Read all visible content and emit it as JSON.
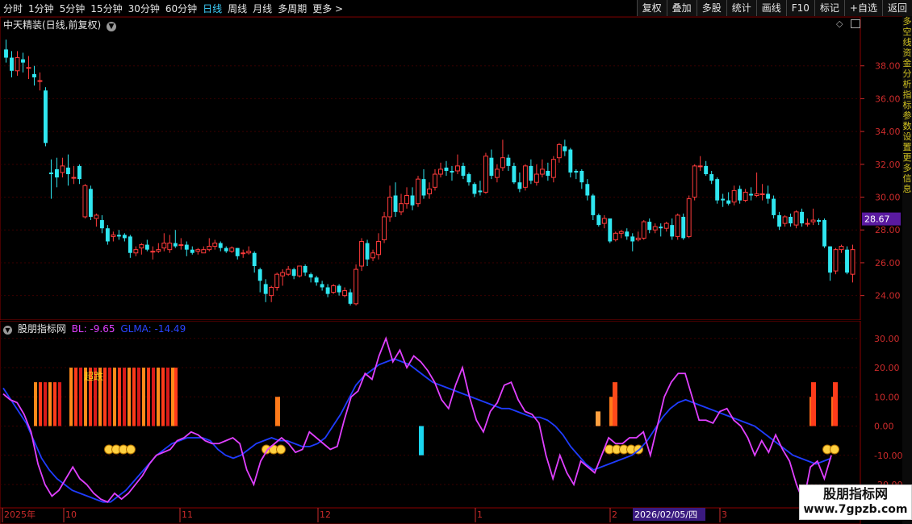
{
  "toolbar": {
    "periods": [
      "分时",
      "1分钟",
      "5分钟",
      "15分钟",
      "30分钟",
      "60分钟",
      "日线",
      "周线",
      "月线",
      "多周期",
      "更多 >"
    ],
    "active_index": 6,
    "right_buttons": [
      "复权",
      "叠加",
      "多股",
      "统计",
      "画线",
      "F10",
      "标记",
      "+自选",
      "返回"
    ]
  },
  "main_chart": {
    "title": "中天精装(日线,前复权)",
    "price_ticks": [
      "38.00",
      "36.00",
      "34.00",
      "32.00",
      "30.00",
      "28.00",
      "26.00",
      "24.00"
    ],
    "current_price": "28.67",
    "current_price_bg": "#5a1aa0"
  },
  "indicator": {
    "name": "股朋指标网",
    "bl_label": "BL: -9.65",
    "glma_label": "GLMA: -14.49",
    "bl_color": "#e040ff",
    "glma_color": "#1f3cff",
    "signal_text": "超跌",
    "ticks": [
      "30.00",
      "20.00",
      "10.00",
      "0.00",
      "-10.00",
      "-20.00"
    ]
  },
  "time_axis": {
    "labels": [
      "2025年",
      "10",
      "11",
      "12",
      "1",
      "2",
      "3"
    ],
    "cursor_date": "2026/02/05/四"
  },
  "watermark": {
    "title": "股朋指标网",
    "url": "www.7gpzb.com"
  },
  "colors": {
    "up": "#ff3b3b",
    "down": "#2fe6f0",
    "grid": "#3a0000",
    "axis_text": "#cc2b2b",
    "border": "#8b0000"
  },
  "chart_data": {
    "type": "candlestick",
    "y_range": [
      23,
      40
    ],
    "candles": [
      [
        39,
        38.5,
        39.6,
        38.2
      ],
      [
        38.5,
        37.7,
        38.9,
        37.3
      ],
      [
        37.7,
        38.5,
        38.9,
        37.4
      ],
      [
        38.4,
        38.2,
        38.8,
        37.6
      ],
      [
        37.9,
        37.9,
        38.6,
        37.2
      ],
      [
        37.5,
        37.3,
        38.0,
        36.8
      ],
      [
        37.1,
        37.1,
        37.6,
        36.5
      ],
      [
        36.5,
        33.3,
        36.7,
        33.1
      ],
      [
        31.5,
        31.4,
        32.3,
        29.9
      ],
      [
        31.7,
        31.2,
        32.4,
        30.6
      ],
      [
        31.5,
        31.9,
        32.4,
        31.2
      ],
      [
        31.8,
        31.4,
        32.6,
        30.7
      ],
      [
        31.2,
        31.2,
        31.9,
        30.8
      ],
      [
        31.9,
        31.1,
        32.0,
        30.8
      ],
      [
        28.8,
        30.7,
        30.8,
        28.7
      ],
      [
        30.5,
        28.8,
        30.7,
        28.6
      ],
      [
        28.7,
        28.9,
        29.0,
        28.2
      ],
      [
        28.6,
        28.1,
        28.9,
        27.8
      ],
      [
        28.1,
        27.3,
        28.3,
        27.1
      ],
      [
        27.6,
        27.7,
        27.9,
        27.3
      ],
      [
        27.7,
        27.6,
        28.0,
        27.4
      ],
      [
        27.7,
        27.5,
        27.8,
        27.3
      ],
      [
        27.6,
        26.6,
        27.7,
        26.3
      ],
      [
        26.6,
        26.8,
        27.0,
        26.4
      ],
      [
        26.9,
        27.1,
        27.2,
        26.5
      ],
      [
        27.1,
        26.8,
        27.4,
        26.7
      ],
      [
        26.7,
        26.7,
        27.0,
        26.2
      ],
      [
        26.7,
        26.8,
        27.2,
        26.6
      ],
      [
        26.9,
        27.2,
        27.8,
        26.7
      ],
      [
        26.8,
        27.2,
        27.7,
        26.6
      ],
      [
        27.2,
        27.0,
        28.0,
        26.9
      ],
      [
        27.1,
        27.1,
        27.5,
        26.8
      ],
      [
        27.1,
        26.8,
        27.3,
        26.4
      ],
      [
        26.8,
        26.6,
        27.0,
        26.5
      ],
      [
        26.7,
        26.8,
        26.9,
        26.5
      ],
      [
        26.6,
        26.8,
        27.0,
        26.6
      ],
      [
        26.8,
        27.0,
        27.5,
        26.7
      ],
      [
        27.0,
        27.2,
        27.4,
        26.8
      ],
      [
        27.2,
        26.9,
        27.3,
        26.7
      ],
      [
        26.9,
        26.7,
        27.0,
        26.6
      ],
      [
        26.7,
        26.9,
        27.0,
        26.6
      ],
      [
        26.9,
        26.4,
        26.9,
        26.2
      ],
      [
        26.6,
        26.6,
        26.8,
        26.3
      ],
      [
        26.6,
        26.7,
        27.0,
        26.5
      ],
      [
        26.6,
        25.8,
        26.7,
        25.4
      ],
      [
        25.6,
        24.9,
        25.7,
        24.2
      ],
      [
        24.7,
        24.1,
        25.0,
        23.6
      ],
      [
        24.0,
        24.5,
        24.6,
        23.6
      ],
      [
        24.5,
        25.3,
        25.4,
        24.3
      ],
      [
        25.2,
        25.4,
        25.6,
        24.6
      ],
      [
        25.3,
        25.6,
        25.8,
        25.2
      ],
      [
        25.6,
        25.2,
        25.7,
        25.0
      ],
      [
        25.2,
        25.8,
        25.8,
        25.1
      ],
      [
        25.8,
        25.4,
        25.9,
        25.2
      ],
      [
        25.3,
        25.1,
        25.4,
        24.8
      ],
      [
        25.1,
        24.8,
        25.2,
        24.6
      ],
      [
        24.7,
        24.5,
        24.9,
        24.3
      ],
      [
        24.5,
        24.1,
        24.7,
        23.9
      ],
      [
        24.2,
        24.6,
        24.7,
        24.1
      ],
      [
        24.6,
        24.2,
        24.7,
        24.0
      ],
      [
        24.0,
        24.3,
        24.5,
        23.9
      ],
      [
        24.2,
        23.5,
        24.4,
        23.4
      ],
      [
        23.5,
        25.6,
        25.9,
        23.4
      ],
      [
        25.8,
        27.3,
        27.5,
        25.5
      ],
      [
        27.2,
        26.2,
        27.4,
        25.8
      ],
      [
        26.3,
        26.6,
        26.8,
        26.1
      ],
      [
        26.5,
        27.3,
        27.8,
        26.2
      ],
      [
        27.4,
        28.8,
        29.1,
        27.2
      ],
      [
        28.8,
        30.0,
        30.7,
        28.5
      ],
      [
        30.1,
        29.1,
        30.9,
        28.8
      ],
      [
        29.1,
        29.6,
        30.2,
        28.9
      ],
      [
        29.6,
        30.1,
        30.6,
        29.3
      ],
      [
        30.1,
        29.5,
        30.6,
        29.2
      ],
      [
        29.6,
        31.1,
        31.3,
        29.4
      ],
      [
        31.1,
        30.1,
        31.7,
        29.9
      ],
      [
        30.2,
        30.5,
        30.9,
        29.9
      ],
      [
        30.6,
        31.4,
        31.7,
        30.4
      ],
      [
        31.4,
        31.7,
        32.1,
        31.2
      ],
      [
        31.8,
        31.6,
        32.2,
        31.3
      ],
      [
        31.6,
        31.5,
        31.9,
        31.0
      ],
      [
        31.6,
        31.9,
        32.6,
        31.4
      ],
      [
        31.9,
        31.3,
        32.1,
        31.1
      ],
      [
        31.4,
        30.9,
        31.5,
        30.7
      ],
      [
        30.8,
        30.2,
        30.9,
        30.0
      ],
      [
        30.4,
        30.3,
        31.0,
        30.1
      ],
      [
        30.3,
        32.5,
        32.7,
        30.2
      ],
      [
        32.4,
        31.3,
        32.9,
        31.1
      ],
      [
        31.2,
        31.7,
        32.0,
        30.9
      ],
      [
        31.8,
        32.4,
        33.5,
        31.6
      ],
      [
        32.4,
        31.9,
        32.6,
        31.6
      ],
      [
        31.9,
        30.9,
        32.1,
        30.8
      ],
      [
        30.9,
        30.5,
        31.5,
        30.3
      ],
      [
        30.6,
        31.9,
        32.0,
        30.4
      ],
      [
        31.9,
        31.0,
        32.3,
        30.8
      ],
      [
        30.9,
        31.4,
        32.0,
        30.7
      ],
      [
        31.4,
        31.7,
        32.3,
        31.2
      ],
      [
        31.6,
        31.3,
        32.1,
        31.0
      ],
      [
        31.2,
        32.3,
        32.5,
        30.9
      ],
      [
        32.4,
        33.2,
        33.3,
        32.1
      ],
      [
        33.1,
        32.8,
        33.5,
        32.5
      ],
      [
        32.9,
        31.5,
        33.0,
        31.2
      ],
      [
        31.6,
        31.5,
        31.7,
        31.1
      ],
      [
        31.6,
        30.9,
        31.7,
        30.5
      ],
      [
        30.8,
        30.1,
        31.1,
        29.8
      ],
      [
        30.1,
        28.9,
        30.2,
        28.6
      ],
      [
        28.9,
        28.3,
        29.0,
        28.2
      ],
      [
        28.4,
        28.7,
        28.9,
        28.1
      ],
      [
        28.7,
        27.3,
        28.7,
        27.2
      ],
      [
        27.4,
        27.8,
        27.9,
        27.3
      ],
      [
        27.8,
        27.9,
        28.0,
        27.5
      ],
      [
        27.9,
        27.6,
        28.1,
        27.4
      ],
      [
        27.6,
        27.3,
        27.8,
        26.7
      ],
      [
        27.4,
        27.5,
        27.9,
        27.3
      ],
      [
        27.5,
        28.5,
        28.6,
        27.4
      ],
      [
        28.5,
        28.0,
        28.7,
        27.8
      ],
      [
        28.0,
        28.2,
        28.4,
        27.8
      ],
      [
        28.2,
        28.1,
        28.4,
        27.6
      ],
      [
        28.1,
        28.4,
        28.5,
        27.9
      ],
      [
        28.3,
        27.6,
        28.7,
        27.4
      ],
      [
        27.6,
        28.9,
        29.0,
        27.4
      ],
      [
        28.8,
        27.5,
        29.0,
        27.4
      ],
      [
        27.6,
        29.9,
        30.1,
        27.5
      ],
      [
        30.0,
        31.9,
        32.0,
        29.8
      ],
      [
        31.9,
        31.9,
        32.5,
        31.6
      ],
      [
        31.9,
        31.4,
        32.2,
        31.3
      ],
      [
        31.4,
        31.0,
        31.6,
        30.8
      ],
      [
        31.1,
        29.8,
        31.2,
        29.6
      ],
      [
        29.9,
        29.8,
        30.2,
        29.4
      ],
      [
        29.8,
        29.6,
        30.3,
        29.5
      ],
      [
        29.7,
        30.4,
        30.7,
        29.5
      ],
      [
        30.5,
        29.8,
        30.7,
        29.6
      ],
      [
        29.8,
        30.3,
        30.5,
        29.7
      ],
      [
        30.2,
        30.1,
        30.6,
        29.8
      ],
      [
        30.1,
        30.2,
        31.5,
        30.0
      ],
      [
        30.2,
        30.2,
        30.8,
        29.8
      ],
      [
        30.2,
        29.9,
        30.7,
        29.6
      ],
      [
        29.9,
        28.9,
        30.1,
        28.7
      ],
      [
        28.9,
        28.2,
        29.1,
        28.0
      ],
      [
        28.4,
        28.8,
        28.9,
        28.2
      ],
      [
        28.8,
        28.4,
        29.0,
        28.2
      ],
      [
        28.3,
        29.1,
        29.2,
        28.1
      ],
      [
        29.1,
        28.4,
        29.3,
        28.2
      ],
      [
        28.4,
        28.4,
        28.7,
        28.2
      ],
      [
        28.5,
        28.6,
        29.3,
        28.3
      ],
      [
        28.6,
        28.5,
        28.7,
        28.3
      ],
      [
        28.6,
        27.0,
        28.7,
        26.9
      ],
      [
        27.0,
        25.4,
        27.0,
        24.9
      ],
      [
        25.5,
        26.8,
        26.9,
        25.3
      ],
      [
        26.8,
        27.0,
        27.1,
        26.6
      ],
      [
        26.8,
        25.4,
        27.0,
        25.3
      ],
      [
        25.3,
        26.8,
        27.1,
        24.8
      ]
    ],
    "indicator_series": {
      "BL": [
        11,
        9,
        8,
        4,
        -2,
        -13,
        -20,
        -24,
        -22,
        -18,
        -14,
        -18,
        -20,
        -23,
        -25,
        -26,
        -23,
        -25,
        -23,
        -20,
        -17,
        -13,
        -10,
        -9,
        -8,
        -5,
        -4,
        -2,
        -3,
        -5,
        -6,
        -6,
        -5,
        -4,
        -6,
        -15,
        -20,
        -12,
        -8,
        -6,
        -4,
        -6,
        -9,
        -8,
        -2,
        -4,
        -6,
        -8,
        -7,
        2,
        10,
        12,
        18,
        16,
        24,
        30,
        22,
        26,
        20,
        24,
        22,
        19,
        15,
        9,
        6,
        14,
        20,
        10,
        2,
        -2,
        5,
        8,
        14,
        15,
        9,
        5,
        4,
        1,
        -10,
        -18,
        -10,
        -16,
        -20,
        -12,
        -14,
        -16,
        -10,
        -4,
        -6,
        -6,
        -4,
        -4,
        -2,
        -10,
        0,
        10,
        15,
        18,
        18,
        10,
        2,
        2,
        1,
        5,
        6,
        2,
        0,
        -4,
        -10,
        -5,
        -9,
        -3,
        -8,
        -12,
        -20,
        -26,
        -14,
        -12,
        -18,
        -10
      ],
      "GLMA": [
        13,
        9,
        5,
        1,
        -5,
        -11,
        -15,
        -18,
        -20,
        -22,
        -23,
        -24,
        -25,
        -26,
        -26,
        -24,
        -22,
        -19,
        -16,
        -13,
        -10,
        -8,
        -6,
        -5,
        -4,
        -4,
        -4,
        -5,
        -8,
        -10,
        -11,
        -10,
        -8,
        -6,
        -5,
        -4,
        -5,
        -5,
        -6,
        -7,
        -7,
        -6,
        -4,
        0,
        4,
        9,
        14,
        17,
        19,
        21,
        22,
        23,
        22,
        21,
        19,
        17,
        15,
        14,
        13,
        12,
        11,
        10,
        9,
        8,
        7,
        6,
        6,
        5,
        4,
        3,
        3,
        2,
        0,
        -3,
        -7,
        -10,
        -13,
        -15,
        -14,
        -13,
        -12,
        -11,
        -10,
        -8,
        -5,
        -1,
        3,
        6,
        8,
        9,
        8,
        7,
        6,
        5,
        4,
        3,
        2,
        1,
        0,
        -2,
        -4,
        -6,
        -8,
        -10,
        -11,
        -12,
        -13,
        -12,
        -11
      ]
    }
  }
}
